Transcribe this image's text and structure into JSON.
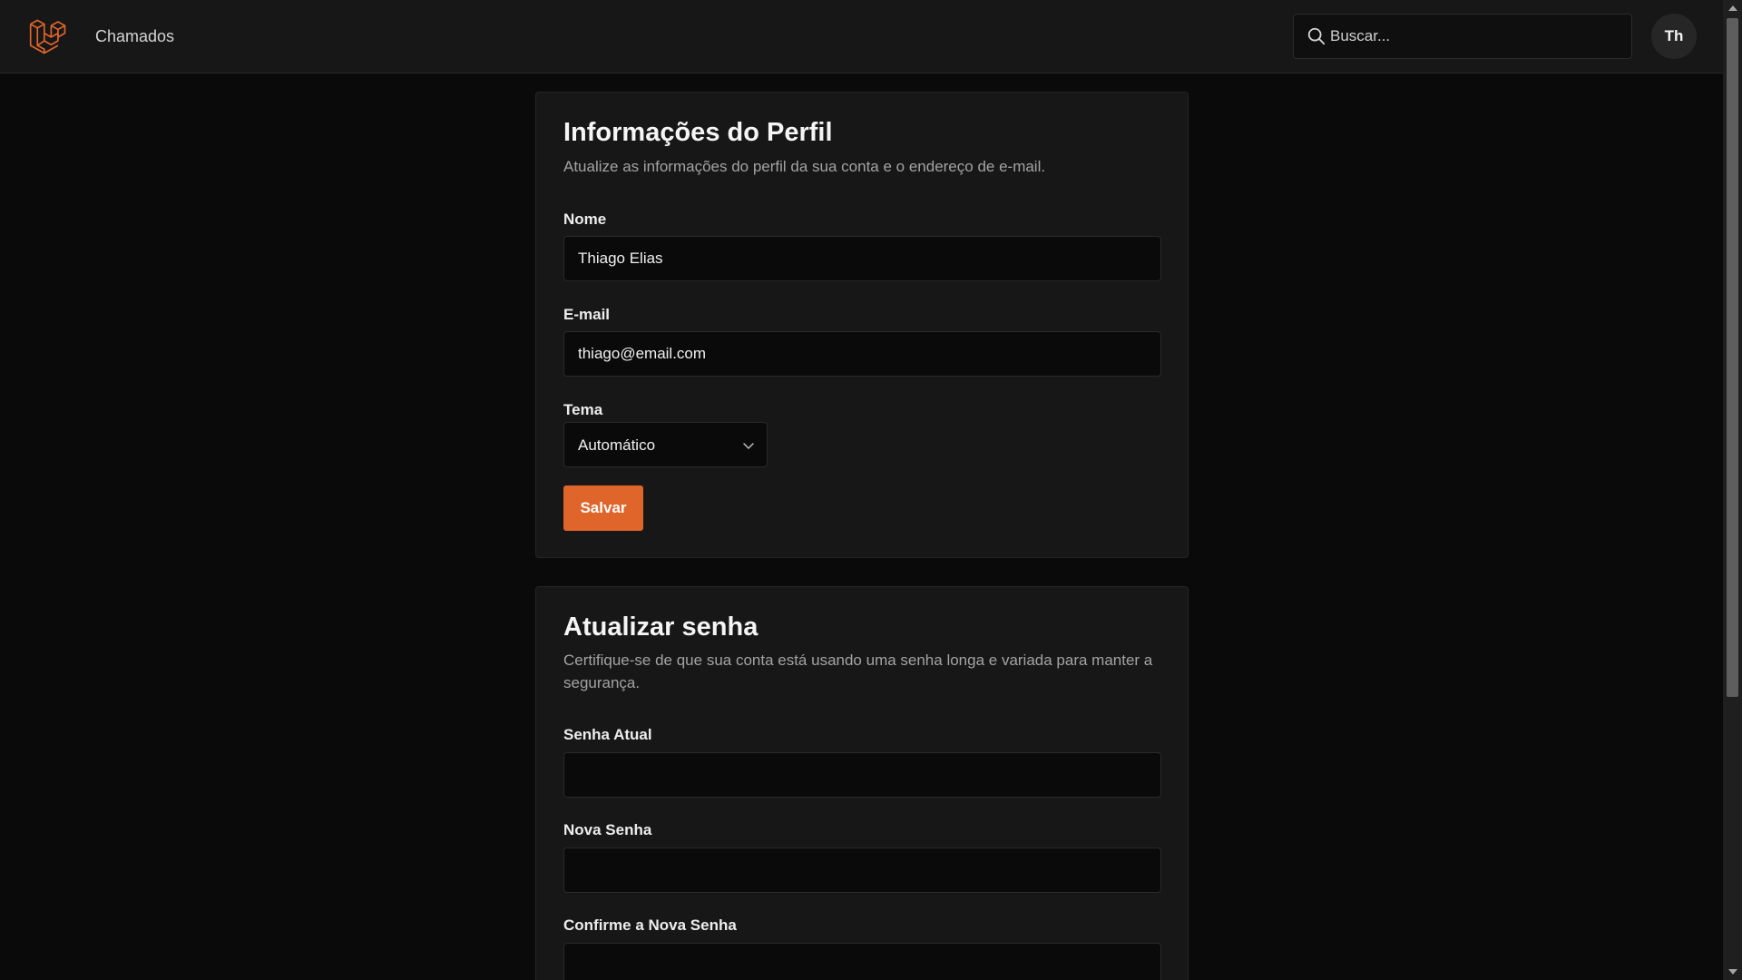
{
  "header": {
    "app_title": "Chamados",
    "logo_icon": "laravel-logo-icon",
    "search_placeholder": "Buscar...",
    "avatar_initials": "Th"
  },
  "profile_card": {
    "title": "Informações do Perfil",
    "description": "Atualize as informações do perfil da sua conta e o endereço de e-mail.",
    "name_label": "Nome",
    "name_value": "Thiago Elias",
    "email_label": "E-mail",
    "email_value": "thiago@email.com",
    "theme_label": "Tema",
    "theme_value": "Automático",
    "save_label": "Salvar"
  },
  "password_card": {
    "title": "Atualizar senha",
    "description": "Certifique-se de que sua conta está usando uma senha longa e variada para manter a segurança.",
    "current_label": "Senha Atual",
    "new_label": "Nova Senha",
    "confirm_label": "Confirme a Nova Senha"
  },
  "colors": {
    "accent": "#e0652b",
    "background": "#0a0a0a",
    "surface": "#171717"
  }
}
